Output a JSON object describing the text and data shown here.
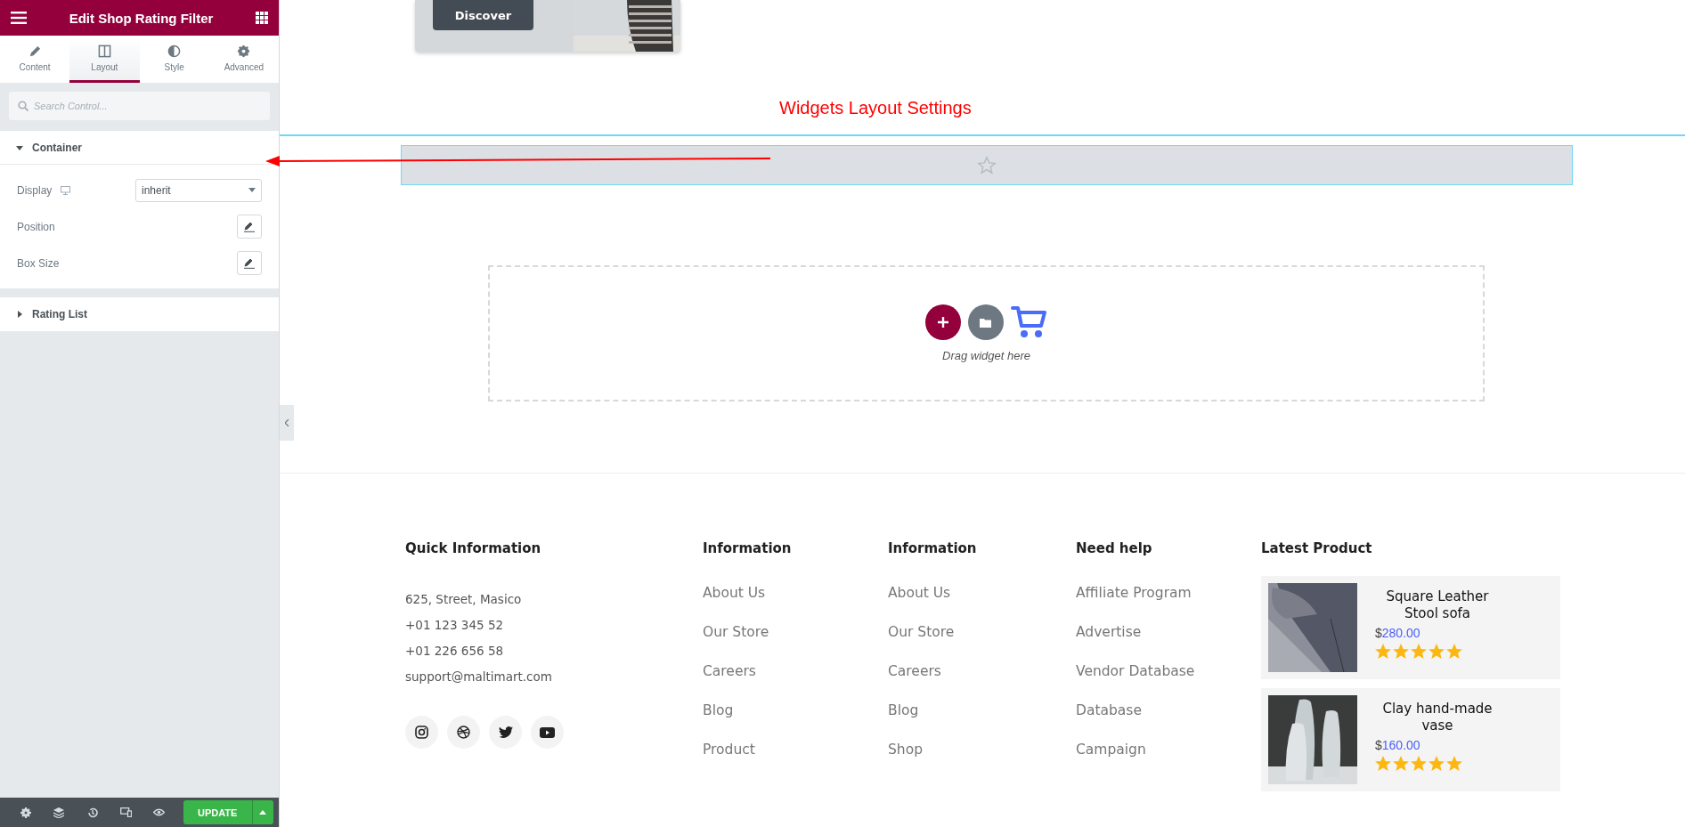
{
  "panel": {
    "title": "Edit Shop Rating Filter",
    "tabs": [
      {
        "label": "Content",
        "selected": false
      },
      {
        "label": "Layout",
        "selected": true
      },
      {
        "label": "Style",
        "selected": false
      },
      {
        "label": "Advanced",
        "selected": false
      }
    ],
    "search": {
      "placeholder": "Search Control..."
    },
    "sections": [
      {
        "title": "Container",
        "expanded": true,
        "controls": [
          {
            "kind": "select",
            "label": "Display",
            "value": "inherit"
          },
          {
            "kind": "edit",
            "label": "Position"
          },
          {
            "kind": "edit",
            "label": "Box Size"
          }
        ]
      },
      {
        "title": "Rating List",
        "expanded": false
      }
    ],
    "footer": {
      "update": "UPDATE"
    }
  },
  "canvas": {
    "hero": {
      "button": "Discover"
    },
    "annotation": "Widgets Layout Settings",
    "dropzone": {
      "hint": "Drag widget here"
    },
    "footer": {
      "quick": {
        "title": "Quick Information",
        "lines": [
          "625, Street, Masico",
          "+01 123 345 52",
          "+01 226 656 58",
          "support@maltimart.com"
        ]
      },
      "columns": [
        {
          "title": "Information",
          "links": [
            "About Us",
            "Our Store",
            "Careers",
            "Blog",
            "Product"
          ]
        },
        {
          "title": "Information",
          "links": [
            "About Us",
            "Our Store",
            "Careers",
            "Blog",
            "Shop"
          ]
        },
        {
          "title": "Need help",
          "links": [
            "Affiliate Program",
            "Advertise",
            "Vendor Database",
            "Database",
            "Campaign"
          ]
        }
      ],
      "latest": {
        "title": "Latest Product",
        "products": [
          {
            "name": "Square Leather Stool sofa",
            "currency": "$",
            "amount": "280.00",
            "stars": 5
          },
          {
            "name": "Clay hand-made vase",
            "currency": "$",
            "amount": "160.00",
            "stars": 5
          }
        ]
      }
    }
  }
}
